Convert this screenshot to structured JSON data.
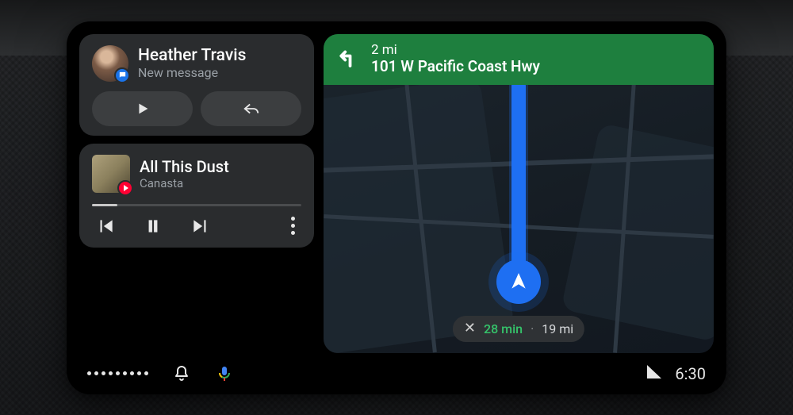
{
  "notification": {
    "sender": "Heather Travis",
    "subtitle": "New message",
    "app_icon": "messages-icon"
  },
  "media": {
    "track": "All This Dust",
    "artist": "Canasta",
    "source_icon": "youtube-music-icon",
    "progress_pct": 12
  },
  "navigation": {
    "maneuver": "turn-left",
    "distance": "2 mi",
    "road": "101 W Pacific Coast Hwy",
    "eta_time": "28 min",
    "eta_distance": "19 mi"
  },
  "status": {
    "clock": "6:30"
  }
}
